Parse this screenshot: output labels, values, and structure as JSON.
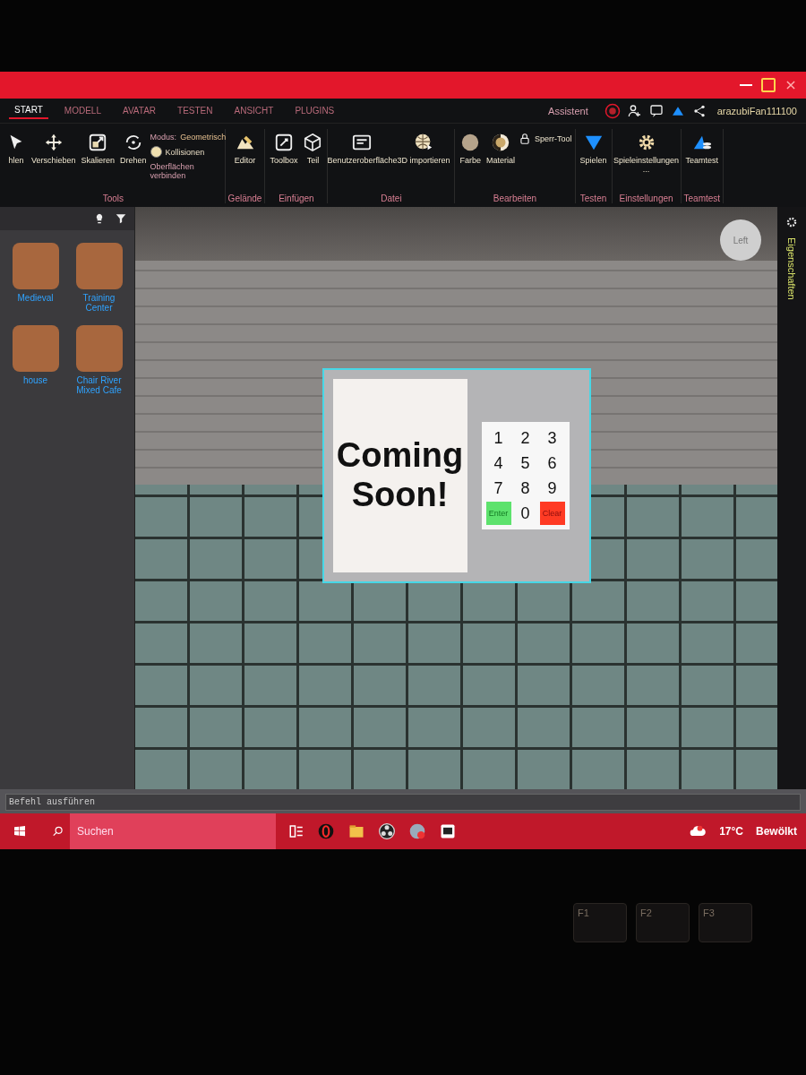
{
  "window": {
    "user": "arazubiFan111100"
  },
  "quick_bar": {
    "assistant": "Assistent"
  },
  "ribbon": {
    "tabs": [
      {
        "label": "START",
        "selected": true
      },
      {
        "label": "MODELL",
        "selected": false
      },
      {
        "label": "AVATAR",
        "selected": false
      },
      {
        "label": "TESTEN",
        "selected": false
      },
      {
        "label": "ANSICHT",
        "selected": false
      },
      {
        "label": "PLUGINS",
        "selected": false
      }
    ],
    "groups": [
      {
        "label": "Tools",
        "tools": [
          {
            "label": "hlen"
          },
          {
            "label": "Verschieben"
          },
          {
            "label": "Skalieren"
          },
          {
            "label": "Drehen"
          }
        ],
        "options": [
          {
            "kind": "select",
            "label": "Modus:",
            "value": "Geometrisch"
          },
          {
            "kind": "checkbox",
            "label": "Kollisionen",
            "checked": true
          },
          {
            "kind": "text",
            "label": "Oberflächen verbinden"
          }
        ]
      },
      {
        "label": "Gelände",
        "tools": [
          {
            "label": "Editor"
          }
        ]
      },
      {
        "label": "Einfügen",
        "tools": [
          {
            "label": "Toolbox"
          },
          {
            "label": "Teil"
          }
        ]
      },
      {
        "label": "Datei",
        "tools": [
          {
            "label": "Benutzeroberfläche"
          },
          {
            "label": "3D importieren"
          }
        ]
      },
      {
        "label": "Bearbeiten",
        "tools": [
          {
            "label": "Farbe"
          },
          {
            "label": "Material"
          }
        ],
        "options": [
          {
            "kind": "lock",
            "label": "Sperr-Tool"
          }
        ]
      },
      {
        "label": "Testen",
        "tools": [
          {
            "label": "Spielen"
          }
        ]
      },
      {
        "label": "Einstellungen",
        "tools": [
          {
            "label": "Spieleinstellungen ..."
          }
        ]
      },
      {
        "label": "Teamtest",
        "tools": [
          {
            "label": "Teamtest"
          }
        ]
      }
    ]
  },
  "toolbox": {
    "items": [
      {
        "name": "Medieval"
      },
      {
        "name": "Training Center"
      },
      {
        "name": "house"
      },
      {
        "name": "Chair River Mixed Cafe"
      }
    ]
  },
  "viewport": {
    "view_cube": "Left",
    "sign": "Coming Soon!",
    "keypad": [
      {
        "label": "1",
        "kind": "digit"
      },
      {
        "label": "2",
        "kind": "digit"
      },
      {
        "label": "3",
        "kind": "digit"
      },
      {
        "label": "4",
        "kind": "digit"
      },
      {
        "label": "5",
        "kind": "digit"
      },
      {
        "label": "6",
        "kind": "digit"
      },
      {
        "label": "7",
        "kind": "digit"
      },
      {
        "label": "8",
        "kind": "digit"
      },
      {
        "label": "9",
        "kind": "digit"
      },
      {
        "label": "Enter",
        "kind": "enter"
      },
      {
        "label": "0",
        "kind": "digit"
      },
      {
        "label": "Clear",
        "kind": "clear"
      }
    ]
  },
  "properties": {
    "title": "Eigenschaften"
  },
  "command_bar": {
    "placeholder": "Befehl ausführen"
  },
  "taskbar": {
    "search": {
      "placeholder": "Suchen"
    },
    "weather": {
      "temperature": "17°C",
      "condition": "Bewölkt"
    }
  },
  "keyboard": {
    "keys": [
      "F1",
      "F2",
      "F3"
    ]
  }
}
